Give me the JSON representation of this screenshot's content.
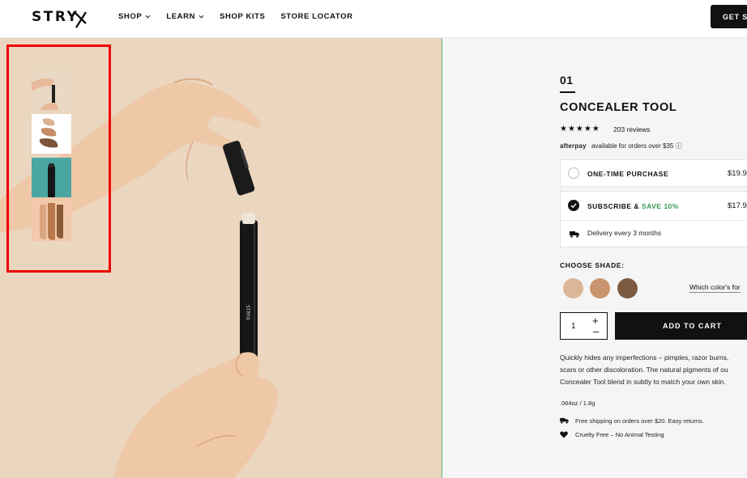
{
  "header": {
    "logo": "STRY",
    "nav": [
      "SHOP",
      "LEARN",
      "SHOP KITS",
      "STORE LOCATOR"
    ],
    "cta": "GET ST"
  },
  "product": {
    "number": "01",
    "title": "CONCEALER TOOL",
    "stars": "★★★★★",
    "reviews": "203 reviews",
    "afterpay_logo": "afterpay",
    "afterpay_text": "available for orders over $35 ⓘ",
    "options": {
      "one_time_label": "ONE-TIME PURCHASE",
      "one_time_price": "$19.9",
      "subscribe_label": "SUBSCRIBE & ",
      "subscribe_save": "SAVE 10%",
      "subscribe_price": "$17.9",
      "delivery": "Delivery every 3 months"
    },
    "shade_label": "CHOOSE SHADE:",
    "shades": [
      "#dbb697",
      "#c9956e",
      "#7c5a41"
    ],
    "which_color": "Which color's for",
    "quantity": "1",
    "plus": "+",
    "minus": "–",
    "add_to_cart": "ADD TO CART",
    "description": [
      "Quickly hides any imperfections – pimples, razor burns,",
      "scars or other discoloration. The natural pigments of ou",
      "Concealer Tool blend in subtly to match your own skin."
    ],
    "size": ".064oz / 1.8g",
    "features": [
      "Free shipping on orders over $20. Easy returns.",
      "Cruelty Free – No Animal Testing"
    ]
  },
  "colors": {
    "accent": "#111111",
    "save_green": "#2e9a4e",
    "photo_bg": "#ebd6c0",
    "highlight": "#ee0000"
  }
}
